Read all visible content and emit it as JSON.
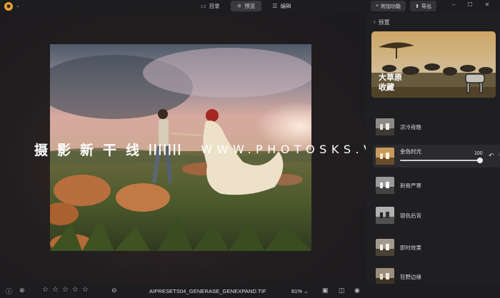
{
  "topbar": {
    "logo_glyph": "✷",
    "logo_caret": "⌄",
    "modes": [
      {
        "label": "目录",
        "icon": "folder-icon",
        "glyph": "▭",
        "active": false
      },
      {
        "label": "预览",
        "icon": "preview-icon",
        "glyph": "⁜",
        "active": true
      },
      {
        "label": "编辑",
        "icon": "sliders-icon",
        "glyph": "☰",
        "active": false
      }
    ],
    "addon_label": "附加功能",
    "addon_glyph": "+",
    "export_label": "导出",
    "export_glyph": "⬆",
    "window_controls": [
      "–",
      "☐",
      "✕"
    ]
  },
  "watermark": {
    "chinese": "摄影新干线",
    "bars": "|||||||",
    "url": "WWW.PHOTOSKS.VIP"
  },
  "panel": {
    "back_glyph": "‹",
    "back_label": "预置",
    "feature_title_line1": "大草原",
    "feature_title_line2": "收藏",
    "presets": [
      {
        "label": "凉冷夜晚"
      },
      {
        "label": "金色时光",
        "selected": true,
        "amount": "100",
        "amount_fraction": 1.0
      },
      {
        "label": "刺骨严寒"
      },
      {
        "label": "银色后背"
      },
      {
        "label": "即时效果"
      },
      {
        "label": "狂野边缘"
      }
    ],
    "undo_glyph": "↶",
    "fav_glyph": "♡"
  },
  "bottombar": {
    "info_glyph": "ⓘ",
    "reject_glyph": "⊗",
    "stars": [
      "☆",
      "☆",
      "☆",
      "☆",
      "☆"
    ],
    "clear_glyph": "⊖",
    "filename": "AIPRESETS04_GENERASE_GENEXPAND.TIF",
    "zoom": "81%",
    "zoom_caret": "⌄",
    "compare_glyph": "▣",
    "split_glyph": "◫",
    "eye_glyph": "◉"
  },
  "colors": {
    "accent": "#f0a431",
    "background": "#1b1a1d",
    "panel": "#1f1e21"
  }
}
